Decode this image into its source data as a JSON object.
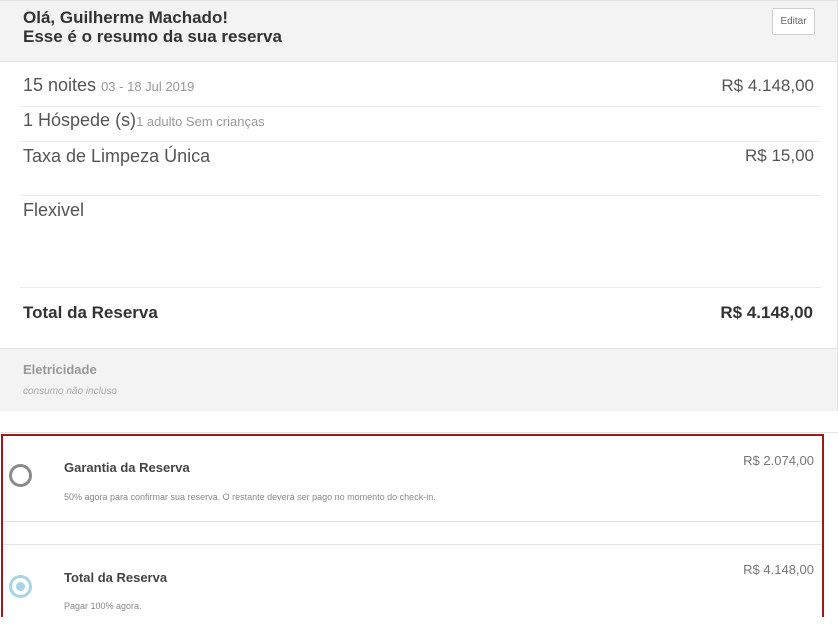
{
  "header": {
    "greeting": "Olá, Guilherme Machado!",
    "subtitle": "Esse é o resumo da sua reserva",
    "edit_label": "Editar"
  },
  "summary": {
    "nights": {
      "label": "15 noites",
      "dates": "03 - 18 Jul 2019",
      "price": "R$ 4.148,00"
    },
    "guests": {
      "label": "1 Hóspede (s)",
      "detail": "1 adulto Sem crianças"
    },
    "cleaning": {
      "label": "Taxa de Limpeza Única",
      "price": "R$ 15,00"
    },
    "policy": {
      "label": "Flexivel"
    },
    "total": {
      "label": "Total da Reserva",
      "value": "R$ 4.148,00"
    }
  },
  "extras": {
    "title": "Eletricidade",
    "note": "consumo não incluso"
  },
  "payment_options": [
    {
      "title": "Garantia da Reserva",
      "price": "R$ 2.074,00",
      "description": "50% agora para confirmar sua reserva. O restante deverá ser pago no momento do check-in.",
      "selected": false
    },
    {
      "title": "Total da Reserva",
      "price": "R$ 4.148,00",
      "description": "Pagar 100% agora.",
      "selected": true
    }
  ],
  "colors": {
    "highlight_border": "#a01818",
    "radio_selected": "#a8d5e2",
    "radio_unselected": "#8a8a8a",
    "header_bg": "#f3f3f3"
  }
}
